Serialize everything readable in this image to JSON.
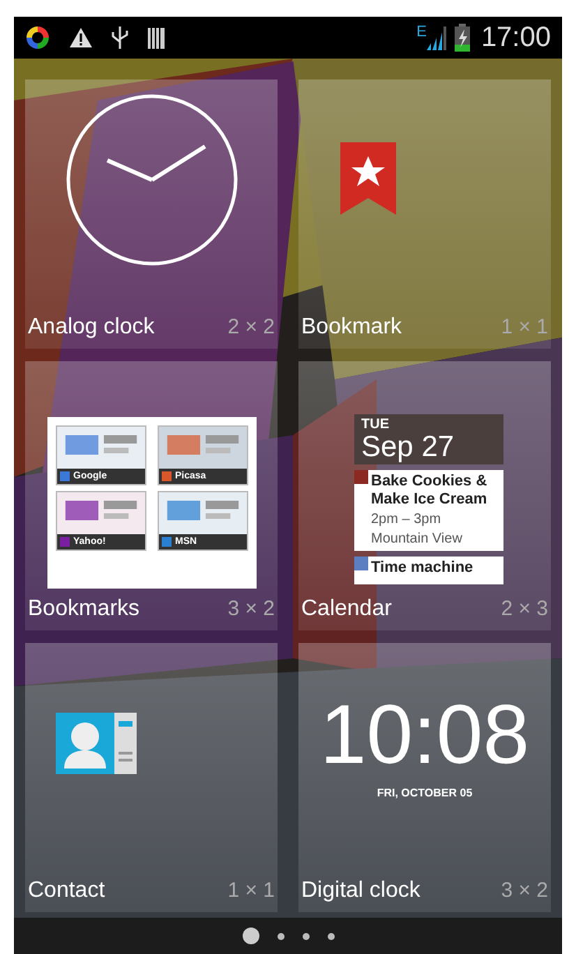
{
  "status_bar": {
    "network_type": "E",
    "time": "17:00"
  },
  "widgets": [
    {
      "kind": "analog_clock",
      "name": "Analog clock",
      "size": "2 × 2"
    },
    {
      "kind": "bookmarks",
      "name": "Bookmarks",
      "size": "3 × 2",
      "sites": [
        "Google",
        "Picasa",
        "Yahoo!",
        "MSN"
      ]
    },
    {
      "kind": "contact",
      "name": "Contact",
      "size": "1 × 1"
    },
    {
      "kind": "bookmark",
      "name": "Bookmark",
      "size": "1 × 1"
    },
    {
      "kind": "calendar",
      "name": "Calendar",
      "size": "2 × 3",
      "day": "TUE",
      "date": "Sep 27",
      "events": [
        {
          "title": "Bake Cookies & Make Ice Cream",
          "time": "2pm – 3pm",
          "place": "Mountain View",
          "color": "#8b2a22"
        },
        {
          "title": "Time machine",
          "color": "#5b7fc0"
        }
      ]
    },
    {
      "kind": "digital_clock",
      "name": "Digital clock",
      "size": "3 × 2",
      "clock": "10:08",
      "date": "FRI, OCTOBER 05"
    }
  ],
  "pages": [
    {
      "selected": true
    },
    {
      "selected": false
    },
    {
      "selected": false
    },
    {
      "selected": false
    }
  ]
}
